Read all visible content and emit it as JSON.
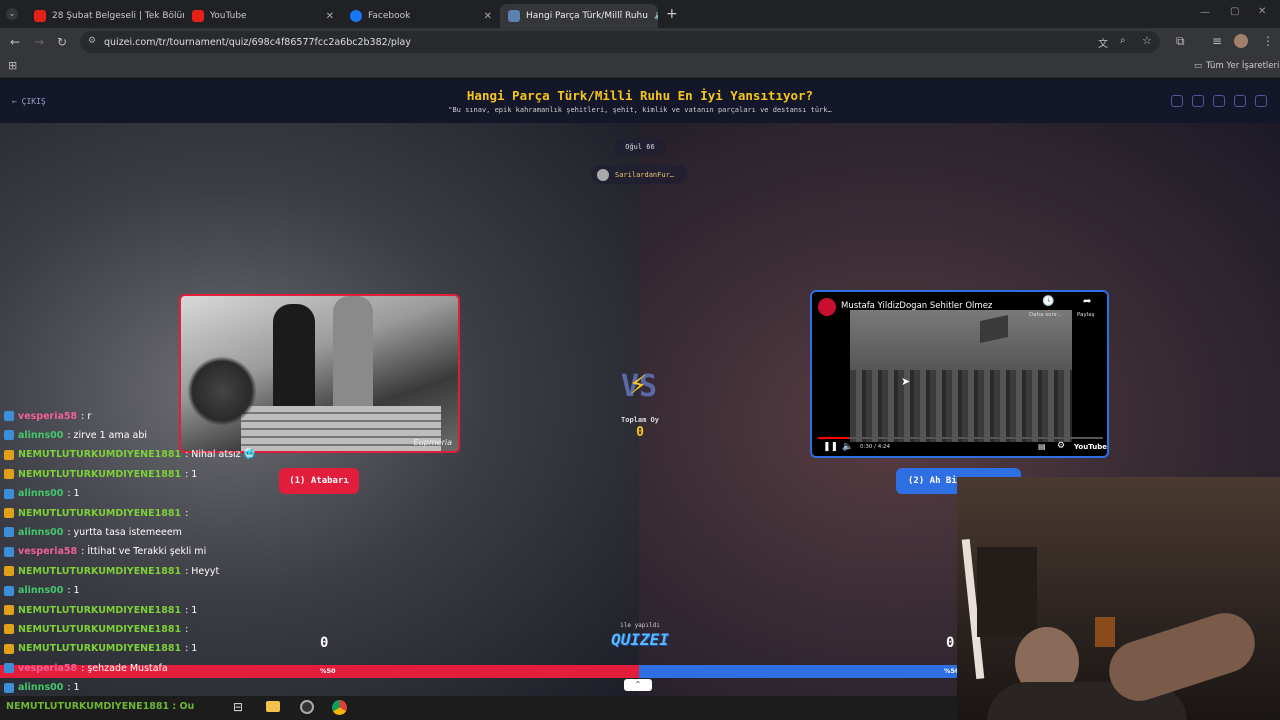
{
  "browser": {
    "tabs": [
      {
        "label": "28 Şubat Belgeseli | Tek Bölüm",
        "icon": "youtube-icon"
      },
      {
        "label": "YouTube",
        "icon": "youtube-icon"
      },
      {
        "label": "Facebook",
        "icon": "facebook-icon"
      },
      {
        "label": "Hangi Parça Türk/Millî Ruhu",
        "icon": "quizei-icon"
      }
    ],
    "url": "quizei.com/tr/tournament/quiz/698c4f86577fcc2a6bc2b382/play",
    "bookmarks_label": "Tüm Yer İşaretleri"
  },
  "quiz": {
    "exit_label": "ÇIKIŞ",
    "title": "Hangi Parça Türk/Milli Ruhu En İyi Yansıtıyor?",
    "subtitle": "\"Bu sınav, epik kahramanlık şehitleri, şehit, kimlik ve vatanın parçaları ve destansı türk…",
    "round_label": "Oğul 66",
    "author": "SarilardanFur…",
    "vs_label": "Toplam Oy",
    "vs_count": "0",
    "left": {
      "button_label": "(1) Atabarı",
      "score": "0",
      "percent": "%50",
      "watermark": "Eupmeria"
    },
    "right": {
      "button_label": "(2) Ah Bi",
      "score": "0",
      "percent": "%50",
      "video_title": "Mustafa YildizDogan Sehitler Olmez",
      "share_label": "Paylaş",
      "more_label": "Daha sonr…",
      "time": "0:30 / 4:24",
      "youtube_label": "YouTube",
      "progress": 0.11
    },
    "credit_prefix": "ile yapıldı",
    "logo": "QUIZEI"
  },
  "chat": [
    {
      "user": "vesperia58",
      "text": ": r",
      "color": "#f06292",
      "badge": "#3a8fd8"
    },
    {
      "user": "alinns00",
      "text": ": zirve 1 ama abi",
      "color": "#43c96b",
      "badge": "#3a8fd8"
    },
    {
      "user": "NEMUTLUTURKUMDIYENE1881",
      "text": ": Nihal atsız 🥶",
      "color": "#7cd137",
      "badge": "#e0a017"
    },
    {
      "user": "NEMUTLUTURKUMDIYENE1881",
      "text": ": 1",
      "color": "#7cd137",
      "badge": "#e0a017"
    },
    {
      "user": "alinns00",
      "text": ": 1",
      "color": "#43c96b",
      "badge": "#3a8fd8"
    },
    {
      "user": "NEMUTLUTURKUMDIYENE1881",
      "text": ":",
      "color": "#7cd137",
      "badge": "#e0a017"
    },
    {
      "user": "alinns00",
      "text": ": yurtta tasa istemeeem",
      "color": "#43c96b",
      "badge": "#3a8fd8"
    },
    {
      "user": "vesperia58",
      "text": ": İttihat ve Terakki şekli mi",
      "color": "#f06292",
      "badge": "#3a8fd8"
    },
    {
      "user": "NEMUTLUTURKUMDIYENE1881",
      "text": ": Heyyt",
      "color": "#7cd137",
      "badge": "#e0a017"
    },
    {
      "user": "alinns00",
      "text": ": 1",
      "color": "#43c96b",
      "badge": "#3a8fd8"
    },
    {
      "user": "NEMUTLUTURKUMDIYENE1881",
      "text": ": 1",
      "color": "#7cd137",
      "badge": "#e0a017"
    },
    {
      "user": "NEMUTLUTURKUMDIYENE1881",
      "text": ":",
      "color": "#7cd137",
      "badge": "#e0a017"
    },
    {
      "user": "NEMUTLUTURKUMDIYENE1881",
      "text": ": 1",
      "color": "#7cd137",
      "badge": "#e0a017"
    },
    {
      "user": "vesperia58",
      "text": ": şehzade Mustafa",
      "color": "#f06292",
      "badge": "#3a8fd8"
    },
    {
      "user": "alinns00",
      "text": ": 1",
      "color": "#43c96b",
      "badge": "#3a8fd8"
    }
  ],
  "taskbar_chat": "NEMUTLUTURKUMDIYENE1881 : Ou",
  "colors": {
    "left": "#e31e3c",
    "right": "#2f6fe4",
    "gold": "#f6c71b"
  }
}
